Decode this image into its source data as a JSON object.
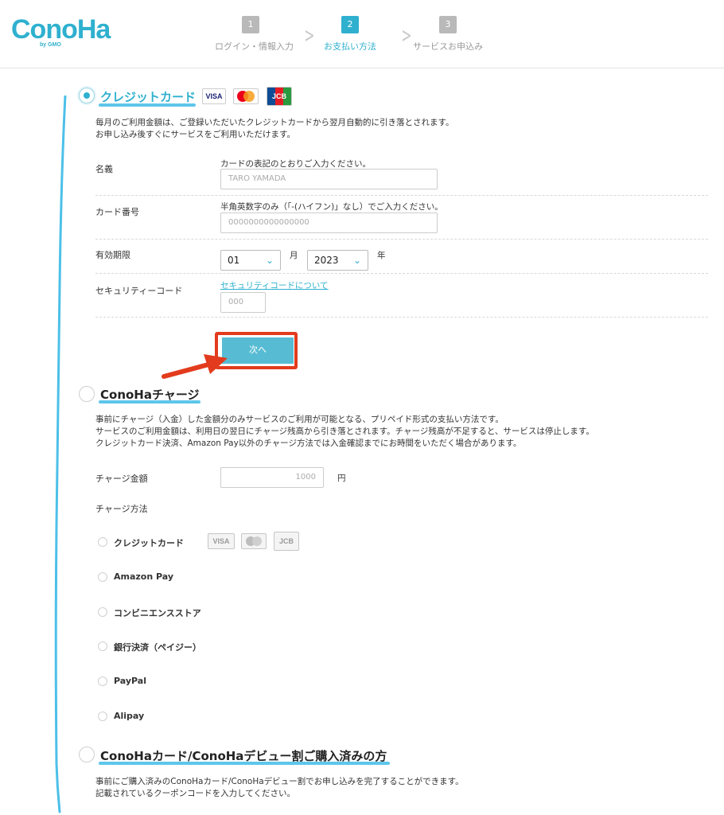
{
  "brand": {
    "name": "ConoHa",
    "sub": "by GMO"
  },
  "steps": [
    {
      "num": "1",
      "label": "ログイン・情報入力"
    },
    {
      "num": "2",
      "label": "お支払い方法"
    },
    {
      "num": "3",
      "label": "サービスお申込み"
    }
  ],
  "credit": {
    "title": "クレジットカード",
    "logos": [
      "VISA",
      "Master",
      "JCB"
    ],
    "desc1": "毎月のご利用金額は、ご登録いただいたクレジットカードから翌月自動的に引き落とされます。",
    "desc2": "お申し込み後すぐにサービスをご利用いただけます。",
    "name_label": "名義",
    "name_hint": "カードの表記のとおりご入力ください。",
    "name_placeholder": "TARO YAMADA",
    "number_label": "カード番号",
    "number_hint": "半角英数字のみ（「-(ハイフン)」なし）でご入力ください。",
    "number_placeholder": "0000000000000000",
    "expiry_label": "有効期限",
    "month_value": "01",
    "month_unit": "月",
    "year_value": "2023",
    "year_unit": "年",
    "cvc_label": "セキュリティーコード",
    "cvc_link": "セキュリティコードについて",
    "cvc_placeholder": "000",
    "next_label": "次へ"
  },
  "charge": {
    "title": "ConoHaチャージ",
    "desc1": "事前にチャージ（入金）した金額分のみサービスのご利用が可能となる、プリペイド形式の支払い方法です。",
    "desc2": "サービスのご利用金額は、利用日の翌日にチャージ残高から引き落とされます。チャージ残高が不足すると、サービスは停止します。",
    "desc3": "クレジットカード決済、Amazon Pay以外のチャージ方法では入金確認までにお時間をいただく場合があります。",
    "amount_label": "チャージ金額",
    "amount_placeholder": "1000",
    "amount_unit": "円",
    "method_label": "チャージ方法",
    "methods": [
      "クレジットカード",
      "Amazon Pay",
      "コンビニエンスストア",
      "銀行決済（ペイジー）",
      "PayPal",
      "Alipay"
    ]
  },
  "coupon": {
    "title": "ConoHaカード/ConoHaデビュー割ご購入済みの方",
    "desc1": "事前にご購入済みのConoHaカード/ConoHaデビュー割でお申し込みを完了することができます。",
    "desc2": "記載されているクーポンコードを入力してください。"
  },
  "colors": {
    "accent": "#2fb0cf",
    "annotation_blue": "#4cc0e8",
    "annotation_red": "#e23b1d"
  }
}
